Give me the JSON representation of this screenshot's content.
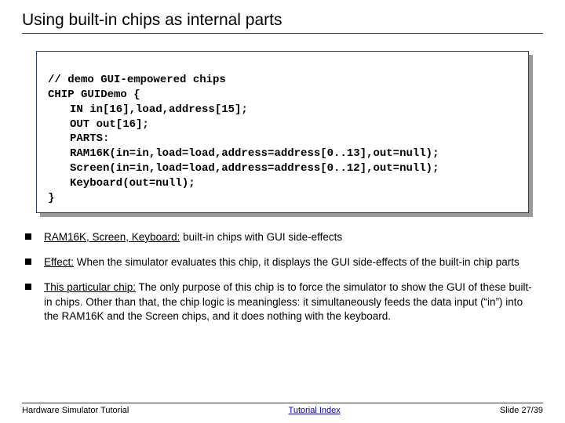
{
  "title": "Using built-in chips as internal parts",
  "code": {
    "l1": "// demo GUI-empowered chips",
    "l2": "CHIP GUIDemo {",
    "l3": "IN in[16],load,address[15];",
    "l4": "OUT out[16];",
    "l5": "PARTS:",
    "l6": "RAM16K(in=in,load=load,address=address[0..13],out=null);",
    "l7": "Screen(in=in,load=load,address=address[0..12],out=null);",
    "l8": "Keyboard(out=null);",
    "l9": "}"
  },
  "bullets": {
    "b1_uline": "RAM16K, Screen, Keyboard:",
    "b1_rest": " built-in chips with GUI side-effects",
    "b2_uline": "Effect:",
    "b2_rest": " When the simulator evaluates this chip, it displays the GUI side-effects of the built-in chip parts",
    "b3_uline": "This particular chip:",
    "b3_rest": " The only purpose of this chip is to force the simulator to show the GUI of these built-in chips. Other than that, the chip logic is meaningless: it simultaneously feeds the data input (“in”) into the RAM16K and the Screen chips, and it does nothing with the keyboard."
  },
  "footer": {
    "left": "Hardware Simulator Tutorial",
    "center": "Tutorial Index",
    "right": "Slide 27/39"
  }
}
